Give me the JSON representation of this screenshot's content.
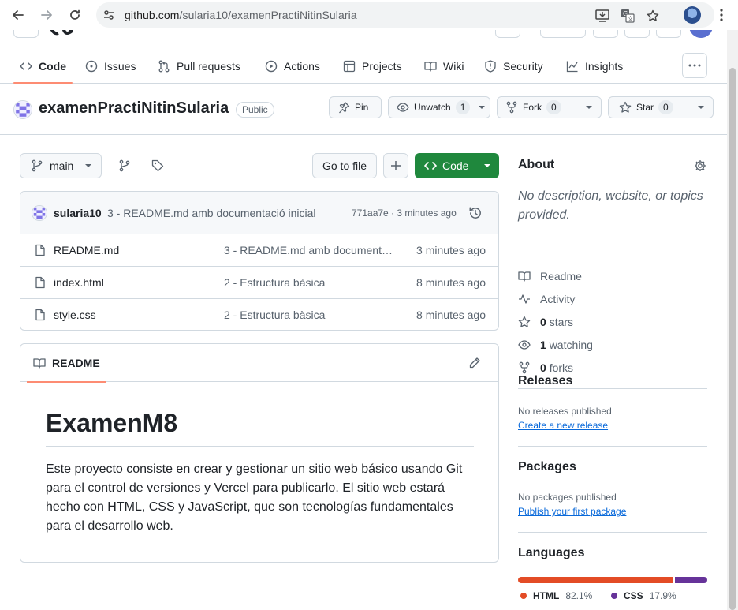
{
  "browser": {
    "url_host": "github.com",
    "url_path": "/sularia10/examenPractiNitinSularia"
  },
  "repo_nav": {
    "tabs": [
      {
        "label": "Code",
        "icon": "code-icon",
        "active": true
      },
      {
        "label": "Issues",
        "icon": "issue-icon"
      },
      {
        "label": "Pull requests",
        "icon": "pull-request-icon"
      },
      {
        "label": "Actions",
        "icon": "play-icon"
      },
      {
        "label": "Projects",
        "icon": "table-icon"
      },
      {
        "label": "Wiki",
        "icon": "book-icon"
      },
      {
        "label": "Security",
        "icon": "shield-icon"
      },
      {
        "label": "Insights",
        "icon": "graph-icon"
      }
    ]
  },
  "repo": {
    "name": "examenPractiNitinSularia",
    "visibility": "Public",
    "pin_label": "Pin",
    "watch_label": "Unwatch",
    "watch_count": "1",
    "fork_label": "Fork",
    "fork_count": "0",
    "star_label": "Star",
    "star_count": "0"
  },
  "toolbar": {
    "branch": "main",
    "goto_file": "Go to file",
    "code_button": "Code"
  },
  "latest_commit": {
    "user": "sularia10",
    "message": "3 - README.md amb documentació inicial",
    "meta": "771aa7e · 3 minutes ago"
  },
  "files": [
    {
      "name": "README.md",
      "message": "3 - README.md amb documentació inicial",
      "time": "3 minutes ago"
    },
    {
      "name": "index.html",
      "message": "2 - Estructura bàsica",
      "time": "8 minutes ago"
    },
    {
      "name": "style.css",
      "message": "2 - Estructura bàsica",
      "time": "8 minutes ago"
    }
  ],
  "readme": {
    "tab_label": "README",
    "heading": "ExamenM8",
    "body": "Este proyecto consiste en crear y gestionar un sitio web básico usando Git para el control de versiones y Vercel para publicarlo. El sitio web estará hecho con HTML, CSS y JavaScript, que son tecnologías fundamentales para el desarrollo web."
  },
  "about": {
    "title": "About",
    "description": "No description, website, or topics provided.",
    "readme": "Readme",
    "activity": "Activity",
    "stars_count": "0",
    "stars_label": "stars",
    "watching_count": "1",
    "watching_label": "watching",
    "forks_count": "0",
    "forks_label": "forks"
  },
  "releases": {
    "title": "Releases",
    "empty": "No releases published",
    "link": "Create a new release"
  },
  "packages": {
    "title": "Packages",
    "empty": "No packages published",
    "link": "Publish your first package"
  },
  "languages": {
    "title": "Languages",
    "items": [
      {
        "name": "HTML",
        "percent": "82.1%",
        "value": 82.1,
        "color": "#e34c26"
      },
      {
        "name": "CSS",
        "percent": "17.9%",
        "value": 17.9,
        "color": "#663399"
      }
    ]
  },
  "colors": {
    "accent_underline": "#fd8c73",
    "primary_green": "#1f883d",
    "link_blue": "#0969da"
  }
}
